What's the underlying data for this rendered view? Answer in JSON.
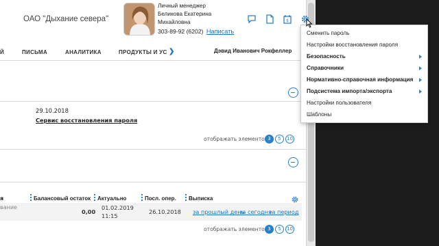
{
  "header": {
    "company": "ОАО \"Дыхание севера\"",
    "manager": {
      "role": "Личный менеджер",
      "surname_name": "Беликова Екатерина",
      "patronymic": "Михайловна",
      "phone": "303-89-92 (6202)",
      "write_link": "Написать"
    },
    "icons": [
      "chat-icon",
      "document-icon",
      "calendar-icon",
      "gear-icon"
    ]
  },
  "nav": {
    "items": [
      "ПИСЬМА",
      "АНАЛИТИКА",
      "ПРОДУКТЫ И УС"
    ],
    "next_icon": "chevron-right-icon",
    "user_name": "Дэвид Иванович Рокфеллер"
  },
  "notice": {
    "date": "29.10.2018",
    "link": "Сервис восстановления пароля"
  },
  "pager": {
    "label": "отображать элементов:",
    "options": [
      "3",
      "5",
      "10"
    ],
    "selected": "3"
  },
  "table": {
    "columns": [
      "Балансовый остаток",
      "Актуально",
      "Посл. опер.",
      "Выписка"
    ],
    "row": {
      "cut_left_1": "вание",
      "cut_left_2": "",
      "balance": "0,00",
      "actual_date": "01.02.2019",
      "actual_time": "11:15",
      "last_op": "26.10.2018",
      "links": [
        "за прошлый день",
        "за сегодня",
        "за период"
      ]
    },
    "pager_label": "отображать элементов:"
  },
  "settings_menu": {
    "items": [
      {
        "label": "Сменить пароль",
        "bold": false,
        "submenu": false
      },
      {
        "label": "Настройки восстановления пароля",
        "bold": false,
        "submenu": false
      },
      {
        "label": "Безопасность",
        "bold": true,
        "submenu": true
      },
      {
        "label": "Справочники",
        "bold": true,
        "submenu": true
      },
      {
        "label": "Нормативно-справочная информация",
        "bold": true,
        "submenu": true
      },
      {
        "label": "Подсистема импорта/экспорта",
        "bold": true,
        "submenu": true
      },
      {
        "label": "Настройки пользователя",
        "bold": false,
        "submenu": false
      },
      {
        "label": "Шаблоны",
        "bold": false,
        "submenu": false
      }
    ]
  },
  "colors": {
    "accent": "#2a7fc9",
    "link": "#1a73c5",
    "side_dark": "#1c1c1c"
  }
}
